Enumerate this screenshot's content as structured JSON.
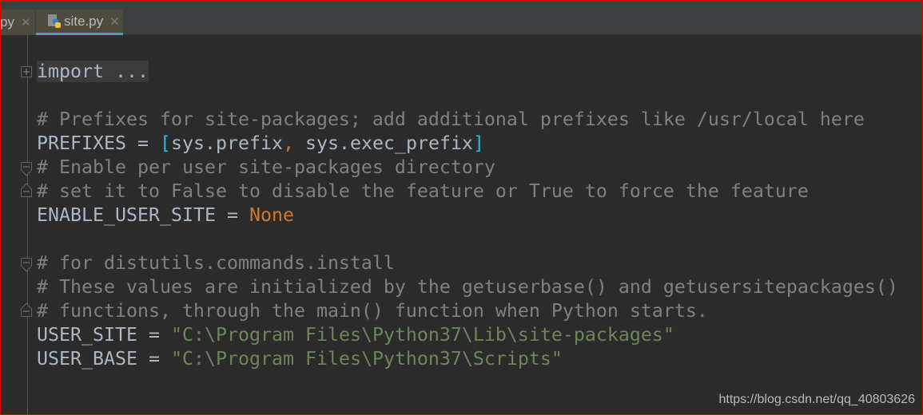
{
  "tabs": [
    {
      "label": "py",
      "active": false,
      "close_icon": "close-icon"
    },
    {
      "label": "site.py",
      "active": true,
      "icon": "python-file-icon",
      "close_icon": "close-icon"
    }
  ],
  "colors": {
    "background": "#2b2b2b",
    "comment": "#808080",
    "identifier": "#a9b7c6",
    "keyword": "#cc7832",
    "string": "#6a8759",
    "bracket": "#2fb4e8",
    "tab_underline": "#4a9fb5"
  },
  "code": {
    "lines": [
      {
        "fold": "fold-expand-icon",
        "tokens": [
          {
            "t": "fold-hl",
            "v": "import ..."
          }
        ]
      },
      {
        "tokens": []
      },
      {
        "tokens": [
          {
            "t": "c",
            "v": "# Prefixes for site-packages; add additional prefixes like /usr/local here"
          }
        ]
      },
      {
        "tokens": [
          {
            "t": "",
            "v": "PREFIXES = "
          },
          {
            "t": "br",
            "v": "["
          },
          {
            "t": "",
            "v": "sys.prefix"
          },
          {
            "t": "cm",
            "v": ", "
          },
          {
            "t": "",
            "v": "sys.exec_prefix"
          },
          {
            "t": "br",
            "v": "]"
          }
        ]
      },
      {
        "fold": "fold-start-icon",
        "tokens": [
          {
            "t": "c",
            "v": "# Enable per user site-packages directory"
          }
        ]
      },
      {
        "fold": "fold-end-icon",
        "tokens": [
          {
            "t": "c",
            "v": "# set it to False to disable the feature or True to force the feature"
          }
        ]
      },
      {
        "tokens": [
          {
            "t": "",
            "v": "ENABLE_USER_SITE = "
          },
          {
            "t": "kw",
            "v": "None"
          }
        ]
      },
      {
        "tokens": []
      },
      {
        "fold": "fold-start-icon",
        "tokens": [
          {
            "t": "c",
            "v": "# for distutils.commands.install"
          }
        ]
      },
      {
        "tokens": [
          {
            "t": "c",
            "v": "# These values are initialized by the getuserbase() and getusersitepackages()"
          }
        ]
      },
      {
        "fold": "fold-end-icon",
        "tokens": [
          {
            "t": "c",
            "v": "# functions, through the main() function when Python starts."
          }
        ]
      },
      {
        "tokens": [
          {
            "t": "",
            "v": "USER_SITE = "
          },
          {
            "t": "s",
            "v": "\"C:\\Program Files\\Python37\\Lib\\site-packages\""
          }
        ]
      },
      {
        "tokens": [
          {
            "t": "",
            "v": "USER_BASE = "
          },
          {
            "t": "s",
            "v": "\"C:\\Program Files\\Python37\\Scripts\""
          }
        ]
      }
    ]
  },
  "watermark": "https://blog.csdn.net/qq_40803626"
}
